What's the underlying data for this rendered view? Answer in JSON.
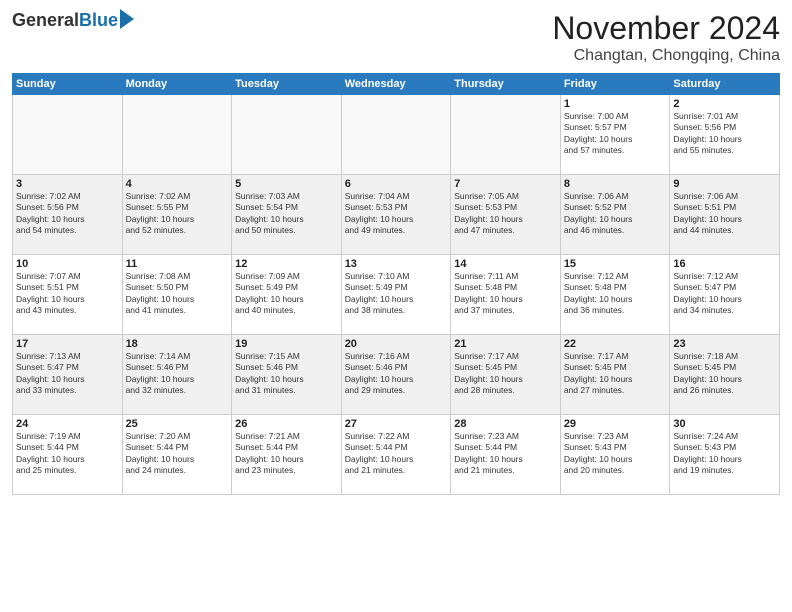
{
  "header": {
    "logo_general": "General",
    "logo_blue": "Blue",
    "title": "November 2024",
    "location": "Changtan, Chongqing, China"
  },
  "days_of_week": [
    "Sunday",
    "Monday",
    "Tuesday",
    "Wednesday",
    "Thursday",
    "Friday",
    "Saturday"
  ],
  "weeks": [
    [
      {
        "day": "",
        "info": ""
      },
      {
        "day": "",
        "info": ""
      },
      {
        "day": "",
        "info": ""
      },
      {
        "day": "",
        "info": ""
      },
      {
        "day": "",
        "info": ""
      },
      {
        "day": "1",
        "info": "Sunrise: 7:00 AM\nSunset: 5:57 PM\nDaylight: 10 hours\nand 57 minutes."
      },
      {
        "day": "2",
        "info": "Sunrise: 7:01 AM\nSunset: 5:56 PM\nDaylight: 10 hours\nand 55 minutes."
      }
    ],
    [
      {
        "day": "3",
        "info": "Sunrise: 7:02 AM\nSunset: 5:56 PM\nDaylight: 10 hours\nand 54 minutes."
      },
      {
        "day": "4",
        "info": "Sunrise: 7:02 AM\nSunset: 5:55 PM\nDaylight: 10 hours\nand 52 minutes."
      },
      {
        "day": "5",
        "info": "Sunrise: 7:03 AM\nSunset: 5:54 PM\nDaylight: 10 hours\nand 50 minutes."
      },
      {
        "day": "6",
        "info": "Sunrise: 7:04 AM\nSunset: 5:53 PM\nDaylight: 10 hours\nand 49 minutes."
      },
      {
        "day": "7",
        "info": "Sunrise: 7:05 AM\nSunset: 5:53 PM\nDaylight: 10 hours\nand 47 minutes."
      },
      {
        "day": "8",
        "info": "Sunrise: 7:06 AM\nSunset: 5:52 PM\nDaylight: 10 hours\nand 46 minutes."
      },
      {
        "day": "9",
        "info": "Sunrise: 7:06 AM\nSunset: 5:51 PM\nDaylight: 10 hours\nand 44 minutes."
      }
    ],
    [
      {
        "day": "10",
        "info": "Sunrise: 7:07 AM\nSunset: 5:51 PM\nDaylight: 10 hours\nand 43 minutes."
      },
      {
        "day": "11",
        "info": "Sunrise: 7:08 AM\nSunset: 5:50 PM\nDaylight: 10 hours\nand 41 minutes."
      },
      {
        "day": "12",
        "info": "Sunrise: 7:09 AM\nSunset: 5:49 PM\nDaylight: 10 hours\nand 40 minutes."
      },
      {
        "day": "13",
        "info": "Sunrise: 7:10 AM\nSunset: 5:49 PM\nDaylight: 10 hours\nand 38 minutes."
      },
      {
        "day": "14",
        "info": "Sunrise: 7:11 AM\nSunset: 5:48 PM\nDaylight: 10 hours\nand 37 minutes."
      },
      {
        "day": "15",
        "info": "Sunrise: 7:12 AM\nSunset: 5:48 PM\nDaylight: 10 hours\nand 36 minutes."
      },
      {
        "day": "16",
        "info": "Sunrise: 7:12 AM\nSunset: 5:47 PM\nDaylight: 10 hours\nand 34 minutes."
      }
    ],
    [
      {
        "day": "17",
        "info": "Sunrise: 7:13 AM\nSunset: 5:47 PM\nDaylight: 10 hours\nand 33 minutes."
      },
      {
        "day": "18",
        "info": "Sunrise: 7:14 AM\nSunset: 5:46 PM\nDaylight: 10 hours\nand 32 minutes."
      },
      {
        "day": "19",
        "info": "Sunrise: 7:15 AM\nSunset: 5:46 PM\nDaylight: 10 hours\nand 31 minutes."
      },
      {
        "day": "20",
        "info": "Sunrise: 7:16 AM\nSunset: 5:46 PM\nDaylight: 10 hours\nand 29 minutes."
      },
      {
        "day": "21",
        "info": "Sunrise: 7:17 AM\nSunset: 5:45 PM\nDaylight: 10 hours\nand 28 minutes."
      },
      {
        "day": "22",
        "info": "Sunrise: 7:17 AM\nSunset: 5:45 PM\nDaylight: 10 hours\nand 27 minutes."
      },
      {
        "day": "23",
        "info": "Sunrise: 7:18 AM\nSunset: 5:45 PM\nDaylight: 10 hours\nand 26 minutes."
      }
    ],
    [
      {
        "day": "24",
        "info": "Sunrise: 7:19 AM\nSunset: 5:44 PM\nDaylight: 10 hours\nand 25 minutes."
      },
      {
        "day": "25",
        "info": "Sunrise: 7:20 AM\nSunset: 5:44 PM\nDaylight: 10 hours\nand 24 minutes."
      },
      {
        "day": "26",
        "info": "Sunrise: 7:21 AM\nSunset: 5:44 PM\nDaylight: 10 hours\nand 23 minutes."
      },
      {
        "day": "27",
        "info": "Sunrise: 7:22 AM\nSunset: 5:44 PM\nDaylight: 10 hours\nand 21 minutes."
      },
      {
        "day": "28",
        "info": "Sunrise: 7:23 AM\nSunset: 5:44 PM\nDaylight: 10 hours\nand 21 minutes."
      },
      {
        "day": "29",
        "info": "Sunrise: 7:23 AM\nSunset: 5:43 PM\nDaylight: 10 hours\nand 20 minutes."
      },
      {
        "day": "30",
        "info": "Sunrise: 7:24 AM\nSunset: 5:43 PM\nDaylight: 10 hours\nand 19 minutes."
      }
    ]
  ]
}
